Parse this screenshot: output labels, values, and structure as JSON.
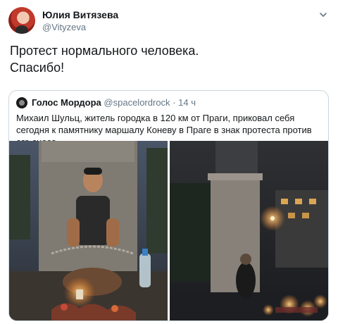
{
  "tweet": {
    "author": {
      "display_name": "Юлия Витязева",
      "handle": "@Vityzeva"
    },
    "text_lines": [
      "Протест нормального человека.",
      "Спасибо!"
    ],
    "menu_icon": "chevron-down-icon"
  },
  "quoted_tweet": {
    "author": {
      "display_name": "Голос Мордора",
      "handle": "@spacelordrock"
    },
    "separator": "·",
    "time": "14 ч",
    "text": "Михаил Шульц, житель городка в 120 км от Праги, приковал себя сегодня к памятнику маршалу Коневу в Праге в знак протеста против его сноса.",
    "photos": [
      {
        "description_icon": "photo-man-chained-to-monument"
      },
      {
        "description_icon": "photo-night-monument-with-candles"
      }
    ]
  },
  "colors": {
    "text_primary": "#14171a",
    "text_secondary": "#657786",
    "border": "#ccd6dd"
  }
}
